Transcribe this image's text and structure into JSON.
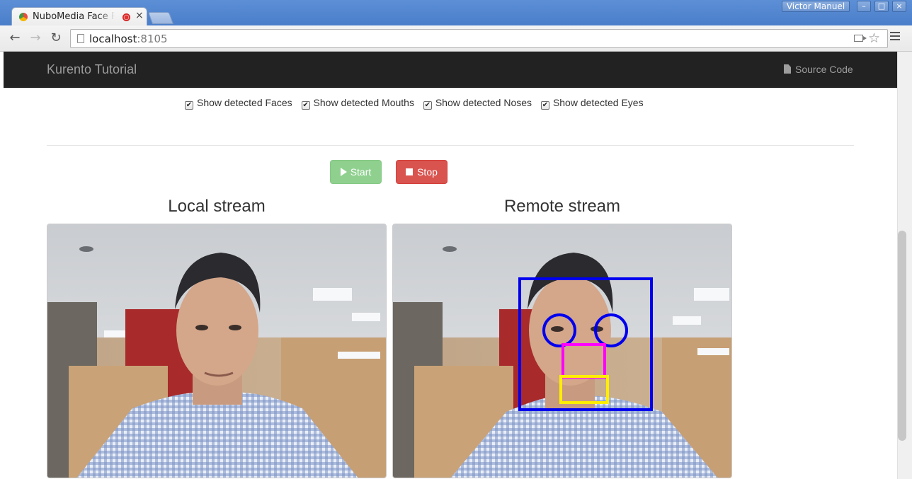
{
  "browser": {
    "tab_title": "NuboMedia Face Recognition",
    "close_glyph": "×",
    "profile_name": "Victor Manuel",
    "window_controls": [
      "–",
      "□",
      "×"
    ],
    "url_host": "localhost",
    "url_port": ":8105",
    "icons": [
      "favicon",
      "recording-icon",
      "back-icon",
      "forward-icon",
      "reload-icon",
      "page-icon",
      "camera-icon",
      "star-icon",
      "menu-icon"
    ]
  },
  "navbar": {
    "brand": "Kurento Tutorial",
    "source_link": "Source Code"
  },
  "options": [
    {
      "label": "Show detected Faces",
      "checked": true
    },
    {
      "label": "Show detected Mouths",
      "checked": true
    },
    {
      "label": "Show detected Noses",
      "checked": true
    },
    {
      "label": "Show detected Eyes",
      "checked": true
    }
  ],
  "controls": {
    "start_label": "Start",
    "stop_label": "Stop",
    "start_enabled": false,
    "stop_enabled": true
  },
  "streams": {
    "local_title": "Local stream",
    "remote_title": "Remote stream"
  },
  "overlay_colors": {
    "face": "#0000ee",
    "eyes": "#0000ee",
    "nose": "#ff00ff",
    "mouth": "#ffee00"
  }
}
